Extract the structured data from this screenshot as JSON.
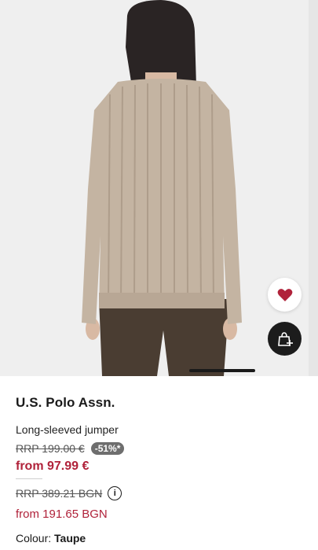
{
  "product": {
    "brand": "U.S. Polo Assn.",
    "type": "Long-sleeved jumper",
    "rrp": "RRP 199.00 €",
    "discount_badge": "-51%*",
    "price": "from 97.99 €",
    "rrp_alt": "RRP 389.21 BGN",
    "price_alt": "from 191.65 BGN",
    "colour_label": "Colour:",
    "colour_value": "Taupe"
  },
  "icons": {
    "wishlist": "heart-icon",
    "add_to_bag": "shopping-bag-plus-icon",
    "info": "info-icon"
  },
  "colors": {
    "price_red": "#b0223a",
    "heart_red": "#b0223a",
    "badge_grey": "#6e6e6e",
    "bag_button": "#1c1c1c"
  }
}
